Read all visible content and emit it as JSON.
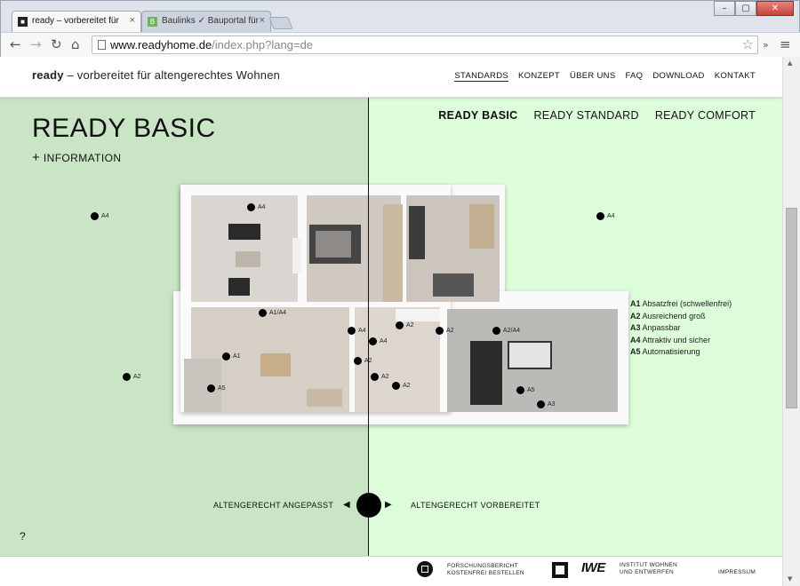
{
  "browser": {
    "tabs": [
      {
        "title": "ready – vorbereitet für",
        "favicon": "ready-favicon"
      },
      {
        "title": "Baulinks ✓ Bauportal für",
        "favicon": "b-favicon"
      }
    ],
    "url_domain": "www.readyhome.de",
    "url_path": "/index.php?lang=de"
  },
  "header": {
    "brand_bold": "ready",
    "brand_rest": " – vorbereitet für altengerechtes Wohnen",
    "nav": [
      "STANDARDS",
      "KONZEPT",
      "ÜBER UNS",
      "FAQ",
      "DOWNLOAD",
      "KONTAKT"
    ]
  },
  "main": {
    "title": "READY BASIC",
    "info_link": "INFORMATION",
    "variants": [
      "READY BASIC",
      "READY STANDARD",
      "READY COMFORT"
    ],
    "slider_left": "ALTENGERECHT ANGEPASST",
    "slider_right": "ALTENGERECHT VORBEREITET",
    "help": "?"
  },
  "markers": [
    "A4",
    "A4",
    "A2",
    "A4",
    "A1/A4",
    "A4",
    "A1",
    "A2",
    "A2",
    "A2/A4",
    "A4",
    "A2",
    "A2",
    "A5",
    "A2",
    "A5",
    "A3"
  ],
  "legend": [
    {
      "code": "A1",
      "text": "Absatzfrei (schwellenfrei)"
    },
    {
      "code": "A2",
      "text": "Ausreichend groß"
    },
    {
      "code": "A3",
      "text": "Anpassbar"
    },
    {
      "code": "A4",
      "text": "Attraktiv und sicher"
    },
    {
      "code": "A5",
      "text": "Automatisierung"
    }
  ],
  "footer": {
    "report_line1": "FORSCHUNGSBERICHT",
    "report_line2": "KOSTENFREI BESTELLEN",
    "iwe": "IWE",
    "institute_line1": "INSTITUT WOHNEN",
    "institute_line2": "UND ENTWERFEN",
    "impressum": "IMPRESSUM"
  },
  "colors": {
    "left_bg": "#c9e5c5",
    "right_bg": "#dcfcda"
  }
}
